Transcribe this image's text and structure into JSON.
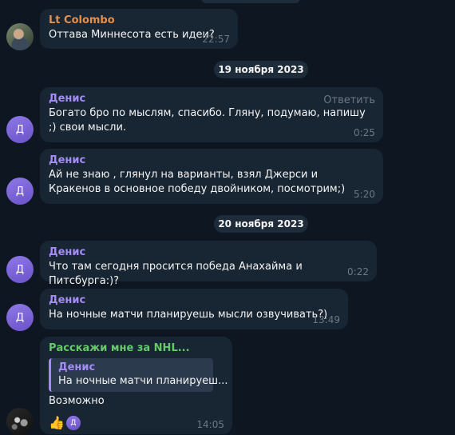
{
  "messages": [
    {
      "avatar_label": "",
      "sender": "Lt Colombo",
      "text": "Оттава Миннесота есть идеи?",
      "time": "22:57"
    },
    {
      "avatar_label": "Д",
      "sender": "Денис",
      "text": "Богато бро по мыслям, спасибо. Гляну, подумаю, напишу ;) свои мысли.",
      "time": "0:25",
      "reply_action": "Ответить"
    },
    {
      "avatar_label": "Д",
      "sender": "Денис",
      "text": "Ай не знаю , глянул на варианты, взял Джерси и Кракенов в основное победу  двойником, посмотрим;)",
      "time": "5:20"
    },
    {
      "avatar_label": "Д",
      "sender": "Денис",
      "text": "Что там сегодня просится победа Анахайма и Питсбурга:)?",
      "time": "0:22"
    },
    {
      "avatar_label": "Д",
      "sender": "Денис",
      "text": "На ночные матчи планируешь мысли озвучивать?)",
      "time": "13:49"
    },
    {
      "avatar_label": "",
      "sender": "Расскажи мне за NHL...",
      "quote_sender": "Денис",
      "quote_text": "На ночные матчи планируеш...",
      "text": "Возможно",
      "time": "14:05",
      "reaction_emoji": "👍",
      "reaction_avatar": "Д"
    }
  ],
  "date_separators": [
    "19 ноября 2023",
    "20 ноября 2023"
  ],
  "colors": {
    "background": "#0e1621",
    "bubble": "#182533",
    "sender_orange": "#e78e4a",
    "sender_violet": "#a38cf4",
    "sender_green": "#68c96b",
    "timestamp": "#6c7883"
  }
}
